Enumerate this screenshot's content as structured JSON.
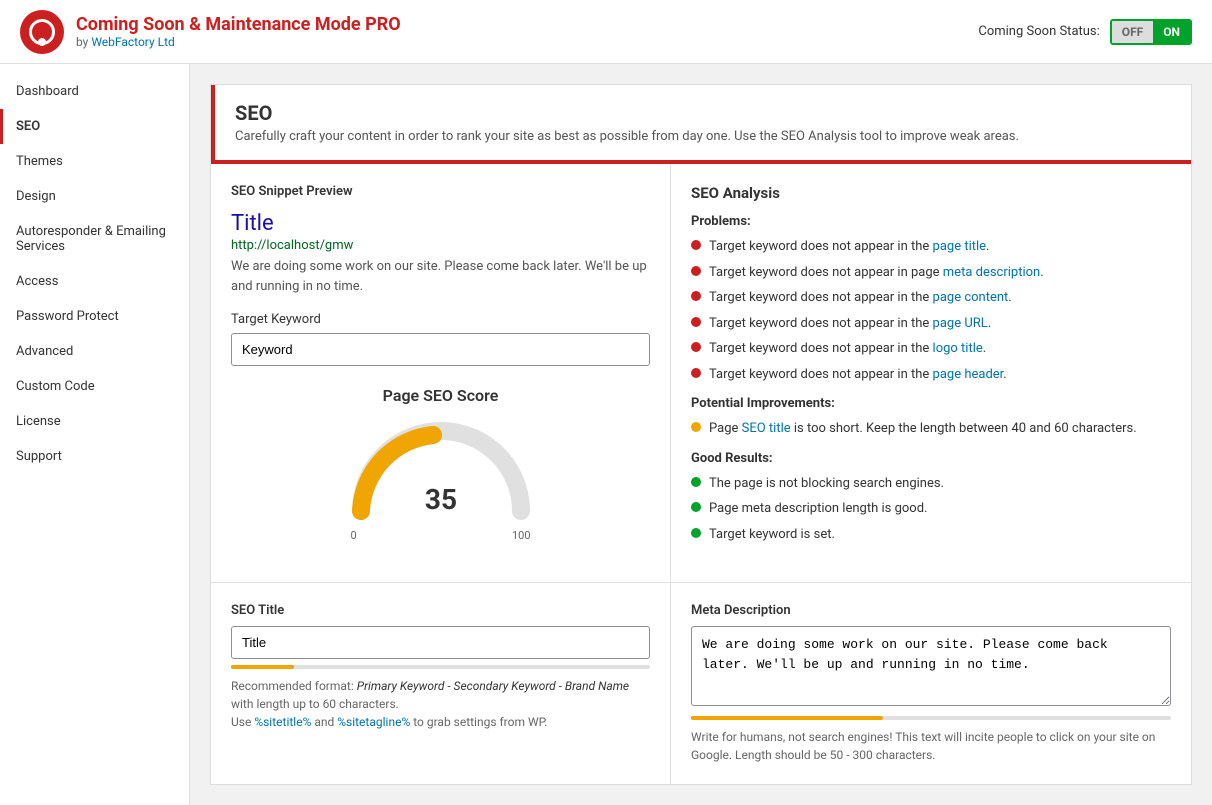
{
  "header": {
    "app_name": "Coming Soon & Maintenance Mode",
    "app_name_suffix": "PRO",
    "by_text": "by",
    "by_link": "WebFactory Ltd",
    "status_label": "Coming Soon Status:",
    "toggle_off": "OFF",
    "toggle_on": "ON"
  },
  "sidebar": {
    "items": [
      {
        "id": "dashboard",
        "label": "Dashboard",
        "active": false
      },
      {
        "id": "seo",
        "label": "SEO",
        "active": true
      },
      {
        "id": "themes",
        "label": "Themes",
        "active": false
      },
      {
        "id": "design",
        "label": "Design",
        "active": false
      },
      {
        "id": "autoresponder",
        "label": "Autoresponder & Emailing Services",
        "active": false
      },
      {
        "id": "access",
        "label": "Access",
        "active": false
      },
      {
        "id": "password-protect",
        "label": "Password Protect",
        "active": false
      },
      {
        "id": "advanced",
        "label": "Advanced",
        "active": false
      },
      {
        "id": "custom-code",
        "label": "Custom Code",
        "active": false
      },
      {
        "id": "license",
        "label": "License",
        "active": false
      },
      {
        "id": "support",
        "label": "Support",
        "active": false
      }
    ]
  },
  "page": {
    "title": "SEO",
    "description": "Carefully craft your content in order to rank your site as best as possible from day one. Use the SEO Analysis tool to improve weak areas."
  },
  "snippet": {
    "section_title": "SEO Snippet Preview",
    "title": "Title",
    "url": "http://localhost/gmw",
    "description": "We are doing some work on our site. Please come back later. We'll be up and running in no time."
  },
  "keyword": {
    "label": "Target Keyword",
    "placeholder": "Keyword",
    "value": "Keyword"
  },
  "score": {
    "title": "Page SEO Score",
    "value": 35,
    "min": 0,
    "max": 100
  },
  "analysis": {
    "title": "SEO Analysis",
    "problems_label": "Problems:",
    "problems": [
      {
        "text": "Target keyword does not appear in the ",
        "link_text": "page title",
        "link_ref": "page_title",
        "after": "."
      },
      {
        "text": "Target keyword does not appear in page ",
        "link_text": "meta description",
        "link_ref": "meta_desc",
        "after": "."
      },
      {
        "text": "Target keyword does not appear in the ",
        "link_text": "page content",
        "link_ref": "page_content",
        "after": "."
      },
      {
        "text": "Target keyword does not appear in the ",
        "link_text": "page URL",
        "link_ref": "page_url",
        "after": "."
      },
      {
        "text": "Target keyword does not appear in the ",
        "link_text": "logo title",
        "link_ref": "logo_title",
        "after": "."
      },
      {
        "text": "Target keyword does not appear in the ",
        "link_text": "page header",
        "link_ref": "page_header",
        "after": "."
      }
    ],
    "improvements_label": "Potential Improvements:",
    "improvements": [
      {
        "text": "Page ",
        "link_text": "SEO title",
        "link_ref": "seo_title",
        "after": " is too short. Keep the length between 40 and 60 characters."
      }
    ],
    "good_label": "Good Results:",
    "good": [
      {
        "text": "The page is not blocking search engines."
      },
      {
        "text": "Page meta description length is good."
      },
      {
        "text": "Target keyword is set."
      }
    ]
  },
  "seo_title": {
    "label": "SEO Title",
    "value": "Title",
    "progress_percent": 15,
    "hint_recommended": "Recommended format:",
    "hint_format": "Primary Keyword - Secondary Keyword - Brand Name",
    "hint_length": "with length up to 60 characters.",
    "hint_vars": "Use %sitetitle% and %sitetagline% to grab settings from WP."
  },
  "meta_description": {
    "label": "Meta Description",
    "value": "We are doing some work on our site. Please come back later. We'll be up and running in no time.",
    "progress_percent": 40,
    "hint": "Write for humans, not search engines! This text will incite people to click on your site on Google. Length should be 50 - 300 characters."
  }
}
